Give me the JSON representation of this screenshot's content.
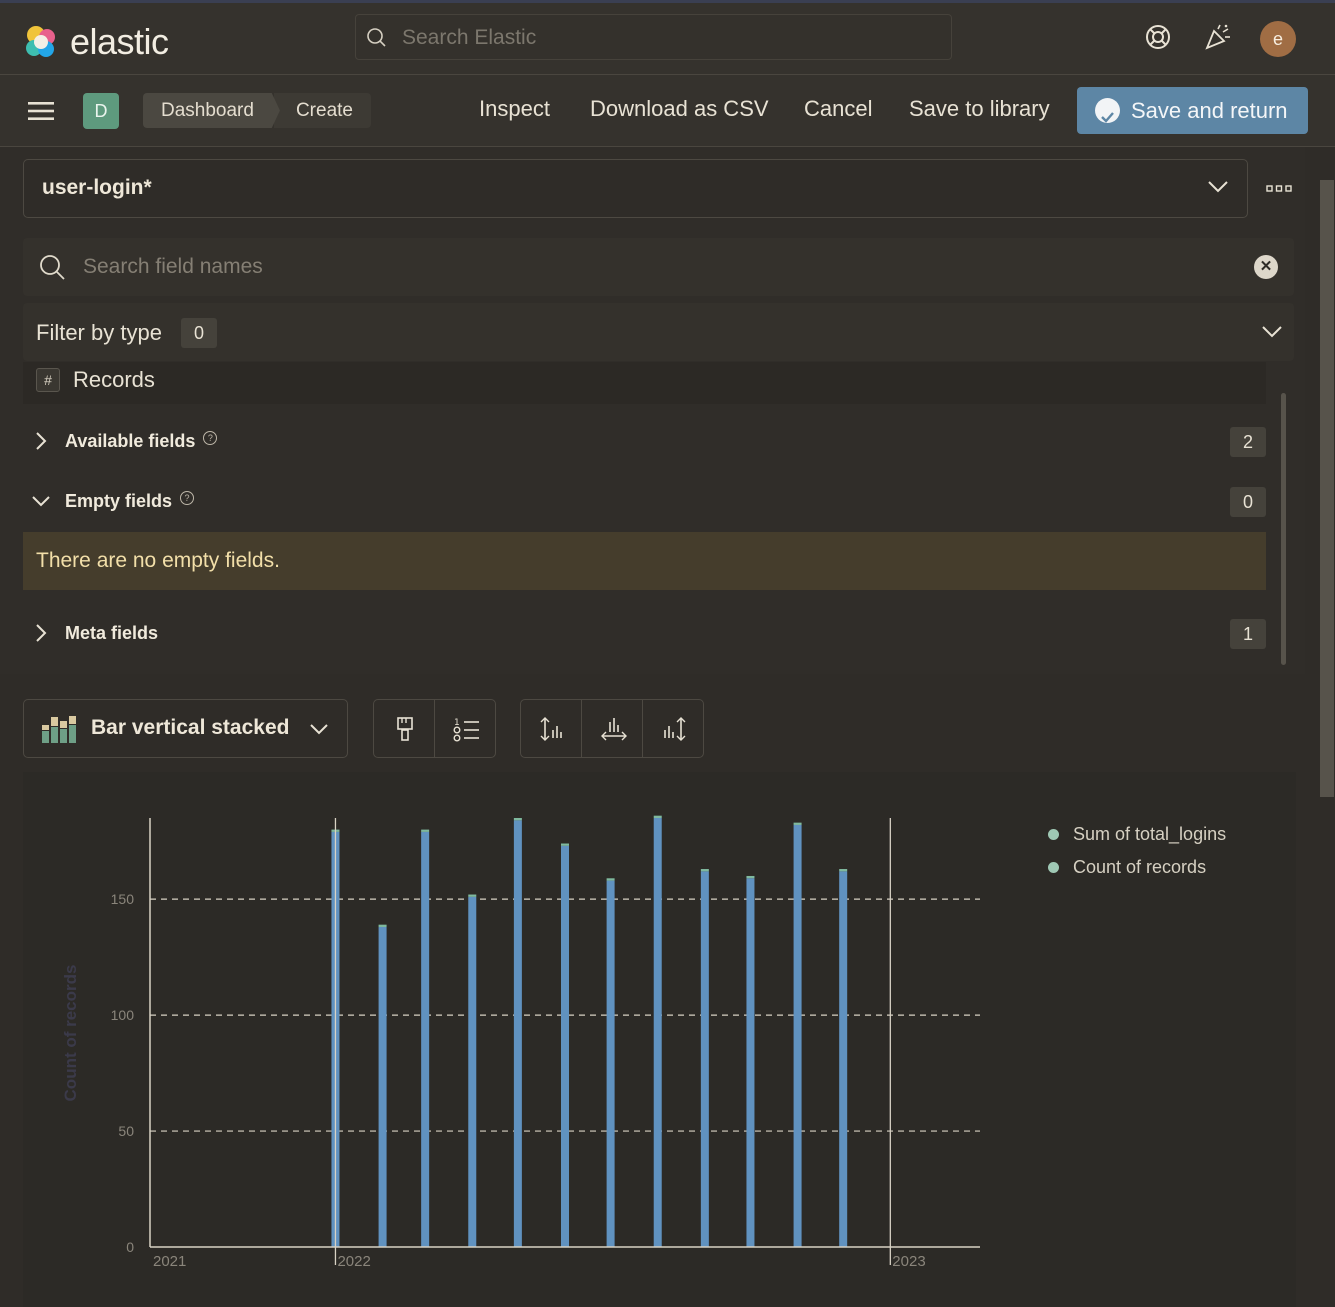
{
  "header": {
    "logo_text": "elastic",
    "search_placeholder": "Search Elastic",
    "avatar_initial": "e"
  },
  "toolbar": {
    "space_badge": "D",
    "breadcrumbs": [
      "Dashboard",
      "Create"
    ],
    "inspect": "Inspect",
    "download_csv": "Download as CSV",
    "cancel": "Cancel",
    "save_library": "Save to library",
    "save_return": "Save and return"
  },
  "panel": {
    "data_view": "user-login*",
    "field_search_placeholder": "Search field names",
    "filter_label": "Filter by type",
    "filter_count": "0",
    "record_type_icon": "#",
    "records_label": "Records",
    "available_label": "Available fields",
    "available_count": "2",
    "empty_label": "Empty fields",
    "empty_count": "0",
    "empty_message": "There are no empty fields.",
    "meta_label": "Meta fields",
    "meta_count": "1"
  },
  "chart_toolbar": {
    "type_label": "Bar vertical stacked"
  },
  "colors": {
    "accent": "#5d86a5",
    "bar": "#6092c0",
    "legend_dot": "#9fc8b4",
    "warning_bg": "#453d2c"
  },
  "chart_data": {
    "type": "bar",
    "stacked": true,
    "ylabel": "Count of records",
    "xlabel": "",
    "ylim": [
      0,
      185
    ],
    "yticks": [
      0,
      50,
      100,
      150
    ],
    "xticks": [
      "2021",
      "2022",
      "2023"
    ],
    "x_domain": [
      "2021-09-01",
      "2023-03-01"
    ],
    "grid": "horizontal dashed",
    "legend": [
      "Sum of total_logins",
      "Count of records"
    ],
    "legend_position": "right",
    "x": [
      "2022-01-01",
      "2022-02-01",
      "2022-03-01",
      "2022-04-01",
      "2022-05-01",
      "2022-06-01",
      "2022-07-01",
      "2022-08-01",
      "2022-09-01",
      "2022-10-01",
      "2022-11-01",
      "2022-12-01"
    ],
    "series": [
      {
        "name": "Sum of total_logins",
        "values": [
          179,
          138,
          179,
          151,
          184,
          173,
          158,
          185,
          162,
          159,
          182,
          162
        ]
      },
      {
        "name": "Count of records",
        "values": [
          1,
          1,
          1,
          1,
          1,
          1,
          1,
          1,
          1,
          1,
          1,
          1
        ]
      }
    ]
  }
}
